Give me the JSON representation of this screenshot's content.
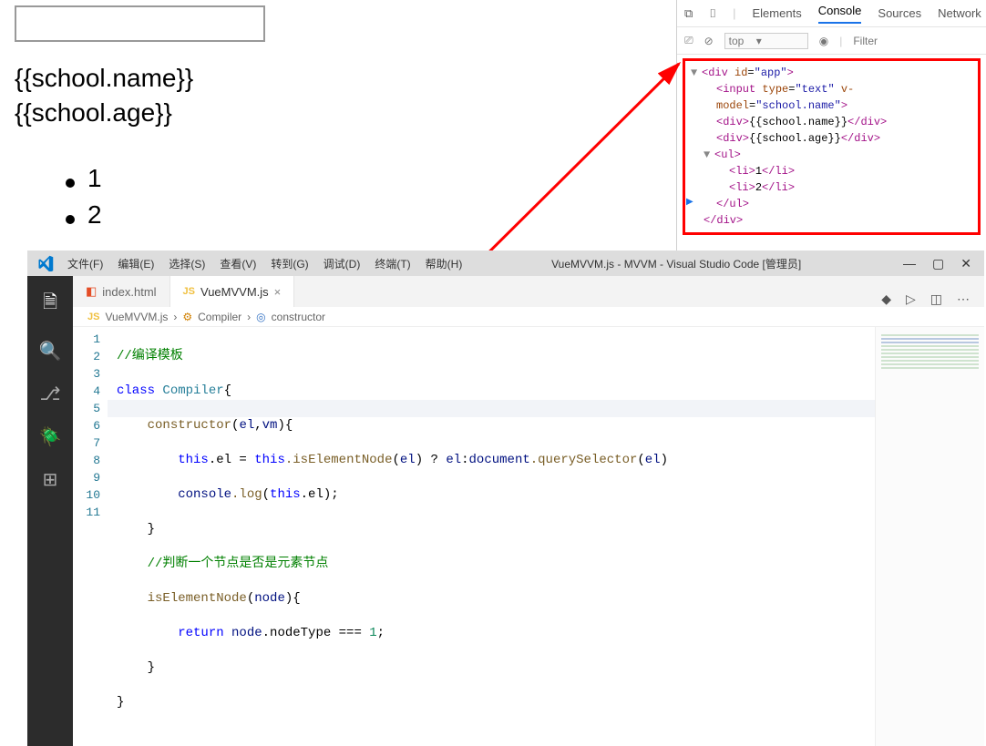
{
  "page": {
    "school_name": "{{school.name}}",
    "school_age": "{{school.age}}",
    "li1": "1",
    "li2": "2"
  },
  "devtools": {
    "tabs": {
      "elements": "Elements",
      "console": "Console",
      "sources": "Sources",
      "network": "Network"
    },
    "filter": {
      "context": "top",
      "placeholder": "Filter"
    },
    "html": {
      "open_div": "<div id=\"app\">",
      "input": "<input type=\"text\" v-model=\"school.name\">",
      "div_name_o": "<div>",
      "div_name_t": "{{school.name}}",
      "div_name_c": "</div>",
      "div_age_o": "<div>",
      "div_age_t": "{{school.age}}",
      "div_age_c": "</div>",
      "ul_open": "<ul>",
      "li1_o": "<li>",
      "li1_t": "1",
      "li1_c": "</li>",
      "li2_o": "<li>",
      "li2_t": "2",
      "li2_c": "</li>",
      "ul_close": "</ul>",
      "close_div": "</div>"
    }
  },
  "vscode": {
    "menus": {
      "file": "文件(F)",
      "edit": "编辑(E)",
      "select": "选择(S)",
      "view": "查看(V)",
      "goto": "转到(G)",
      "debug": "调试(D)",
      "terminal": "终端(T)",
      "help": "帮助(H)"
    },
    "title": "VueMVVM.js - MVVM - Visual Studio Code [管理员]",
    "tabs": {
      "index": "index.html",
      "vuemvvm": "VueMVVM.js"
    },
    "breadcrumb": {
      "file": "VueMVVM.js",
      "cls": "Compiler",
      "ctor": "constructor"
    },
    "lines": [
      "1",
      "2",
      "3",
      "4",
      "5",
      "6",
      "7",
      "8",
      "9",
      "10",
      "11"
    ],
    "code": {
      "l1_cmt": "//编译模板",
      "l2_a": "class ",
      "l2_b": "Compiler",
      "l2_c": "{",
      "l3_a": "constructor",
      "l3_b": "(",
      "l3_c1": "el",
      "l3_comma": ",",
      "l3_c2": "vm",
      "l3_d": ")",
      "l3_e": "{",
      "l4_a": "this",
      "l4_b": ".el = ",
      "l4_c": "this",
      "l4_d": ".isElementNode",
      "l4_e": "(",
      "l4_f": "el",
      "l4_g": ") ? ",
      "l4_h": "el",
      "l4_i": ":",
      "l4_j": "document",
      "l4_k": ".querySelector",
      "l4_l": "(",
      "l4_m": "el",
      "l4_n": ")",
      "l5_a": "console",
      "l5_b": ".log",
      "l5_c": "(",
      "l5_d": "this",
      "l5_e": ".el);",
      "l6": "}",
      "l7_cmt": "//判断一个节点是否是元素节点",
      "l8_a": "isElementNode",
      "l8_b": "(",
      "l8_c": "node",
      "l8_d": ")",
      "l8_e": "{",
      "l9_a": "return ",
      "l9_b": "node",
      "l9_c": ".nodeType === ",
      "l9_d": "1",
      "l9_e": ";",
      "l10": "}",
      "l11": "}"
    }
  }
}
